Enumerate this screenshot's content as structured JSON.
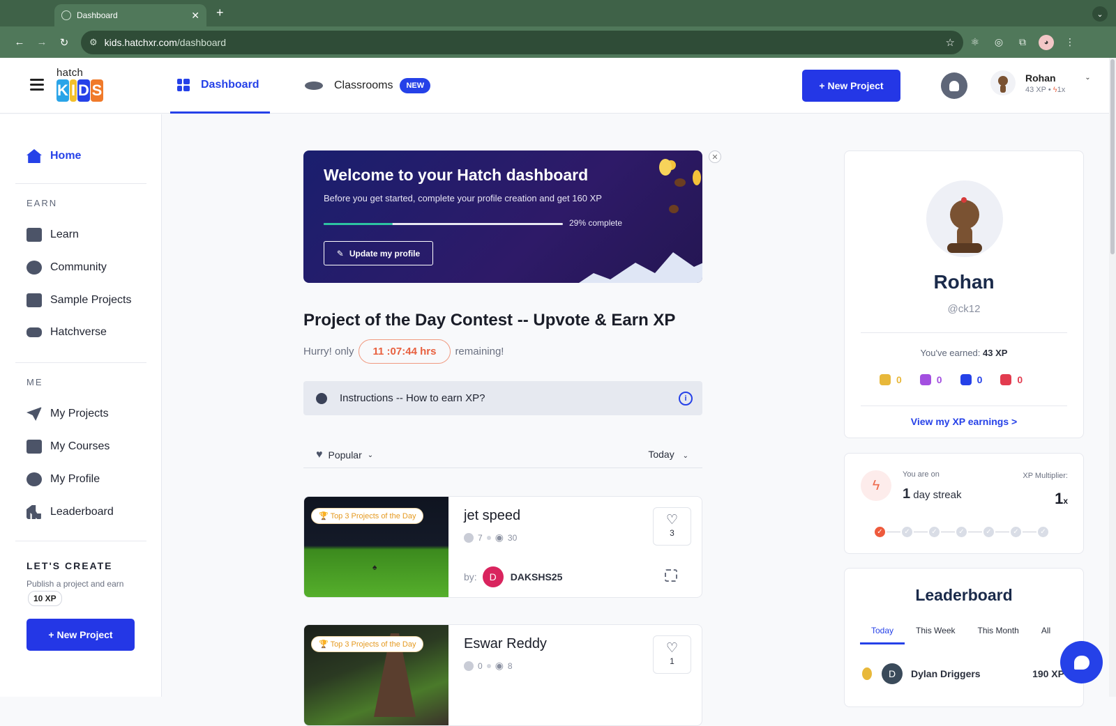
{
  "browser": {
    "tab_title": "Dashboard",
    "url_domain": "kids.hatchxr.com",
    "url_path": "/dashboard"
  },
  "header": {
    "logo_top": "hatch",
    "logo_bottom": "KIDS",
    "nav": [
      {
        "label": "Dashboard",
        "active": true
      },
      {
        "label": "Classrooms",
        "badge": "NEW"
      }
    ],
    "new_project": "+ New Project",
    "user": {
      "name": "Rohan",
      "xp": "43 XP",
      "multiplier": "1x"
    }
  },
  "sidebar": {
    "home": "Home",
    "earn_section": "EARN",
    "earn_items": [
      "Learn",
      "Community",
      "Sample Projects",
      "Hatchverse"
    ],
    "me_section": "ME",
    "me_items": [
      "My Projects",
      "My Courses",
      "My Profile",
      "Leaderboard"
    ],
    "create_title": "LET'S CREATE",
    "create_text": "Publish a project and earn",
    "create_xp": "10 XP",
    "new_project": "+ New Project"
  },
  "banner": {
    "title": "Welcome to your Hatch dashboard",
    "text": "Before you get started, complete your profile creation and get 160 XP",
    "progress_percent": 29,
    "progress_label": "29% complete",
    "button": "Update my profile"
  },
  "contest": {
    "title": "Project of the Day Contest -- Upvote & Earn XP",
    "hurry_prefix": "Hurry! only",
    "timer": "11 :07:44 hrs",
    "hurry_suffix": "remaining!",
    "instructions": "Instructions -- How to earn XP?",
    "filter_sort": "Popular",
    "filter_time": "Today"
  },
  "projects": [
    {
      "badge": "Top 3 Projects of the Day",
      "title": "jet speed",
      "comments": "7",
      "views": "30",
      "likes": "3",
      "by_label": "by:",
      "author_initial": "D",
      "author": "DAKSHS25"
    },
    {
      "badge": "Top 3 Projects of the Day",
      "title": "Eswar Reddy",
      "comments": "0",
      "views": "8",
      "likes": "1"
    }
  ],
  "profile": {
    "name": "Rohan",
    "handle": "@ck12",
    "earned_label": "You've earned:",
    "earned_value": "43 XP",
    "badge_counts": [
      "0",
      "0",
      "0",
      "0"
    ],
    "badge_colors": [
      "#e8b83a",
      "#a34fe0",
      "#2541e8",
      "#e23b4f"
    ],
    "view_link": "View my XP earnings >"
  },
  "streak": {
    "on_label": "You are on",
    "days_num": "1",
    "days_label": "day streak",
    "mult_label": "XP Multiplier:",
    "mult_value": "1",
    "mult_suffix": "x",
    "completed_days": 1,
    "total_days": 7
  },
  "leaderboard": {
    "title": "Leaderboard",
    "tabs": [
      "Today",
      "This Week",
      "This Month",
      "All"
    ],
    "rows": [
      {
        "initial": "D",
        "name": "Dylan Driggers",
        "xp": "190 XP"
      }
    ]
  }
}
